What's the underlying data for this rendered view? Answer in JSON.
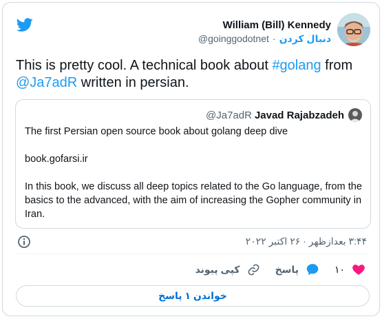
{
  "author": {
    "name": "William (Bill) Kennedy",
    "handle": "@goinggodotnet",
    "follow_label": "دنبال کردن",
    "separator": "·"
  },
  "tweet": {
    "text_before": "This is pretty cool. A technical book about ",
    "hashtag": "#golang",
    "text_mid": " from ",
    "mention": "@Ja7adR",
    "text_after": " written in persian."
  },
  "quote": {
    "name": "Javad Rajabzadeh",
    "handle": "@Ja7adR",
    "line1": "The first Persian open source book about golang deep dive",
    "line2": "book.gofarsi.ir",
    "line3": "In this book, we discuss all deep topics related to the Go language, from the basics to the advanced, with the aim of increasing the Gopher community in Iran."
  },
  "meta": {
    "timestamp": "۳:۴۴ بعدازظهر · ۲۶ اکتبر ۲۰۲۲"
  },
  "actions": {
    "likes": "۱۰",
    "reply_label": "پاسخ",
    "copy_link_label": "کپی پیوند"
  },
  "read_replies": {
    "label": "خواندن ۱ پاسخ"
  },
  "colors": {
    "brand_blue": "#1d9bf0",
    "like_pink": "#f91880",
    "muted_text": "#536471",
    "border": "#cfd9de"
  },
  "icons": {
    "logo": "twitter-bird-icon",
    "info": "info-icon",
    "like": "heart-icon",
    "reply": "speech-bubble-icon",
    "copy": "link-icon"
  }
}
